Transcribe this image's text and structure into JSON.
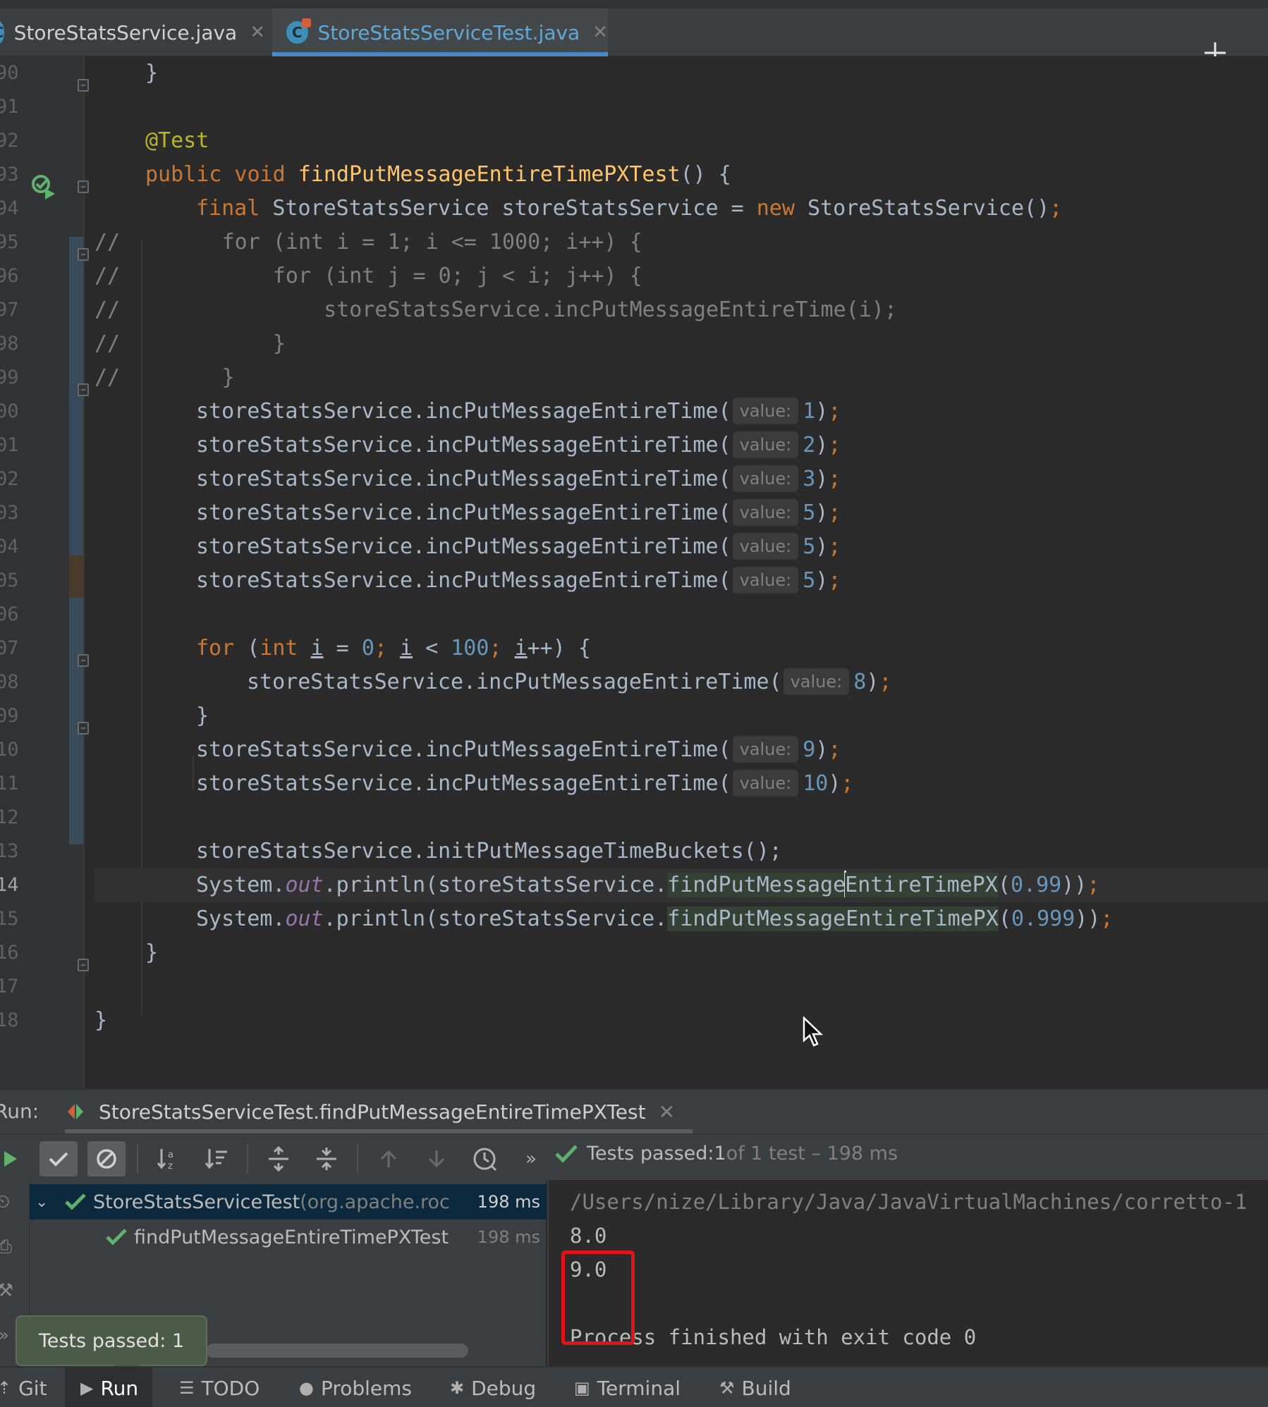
{
  "tabs": [
    {
      "label": "StoreStatsService.java",
      "active": false
    },
    {
      "label": "StoreStatsServiceTest.java",
      "active": true
    }
  ],
  "editor": {
    "line_numbers": [
      "90",
      "91",
      "92",
      "93",
      "94",
      "95",
      "96",
      "97",
      "98",
      "99",
      "00",
      "01",
      "02",
      "03",
      "04",
      "05",
      "06",
      "07",
      "08",
      "09",
      "10",
      "11",
      "12",
      "13",
      "14",
      "15",
      "16",
      "17",
      "18"
    ],
    "current_line": "14",
    "lines": {
      "l90": "}",
      "annotation": "@Test",
      "kw_public_void": "public void ",
      "method_name": "findPutMessageEntireTimePXTest",
      "method_tail": "() {",
      "kw_final": "final ",
      "decl_mid": "StoreStatsService storeStatsService = ",
      "kw_new": "new ",
      "decl_tail": "StoreStatsService()",
      "semi": ";",
      "c95": "//        for (int i = 1; i <= 1000; i++) {",
      "c96": "//            for (int j = 0; j < i; j++) {",
      "c97": "//                storeStatsService.incPutMessageEntireTime(i);",
      "c98": "//            }",
      "c99": "//        }",
      "inc_call": "storeStatsService.incPutMessageEntireTime(",
      "hint": "value:",
      "close": ")",
      "v100": "1",
      "v101": "2",
      "v102": "3",
      "v103": "5",
      "v104": "5",
      "v105": "5",
      "v108": "8",
      "v110": "9",
      "v111": "10",
      "kw_for": "for ",
      "for_open": "(",
      "kw_int": "int ",
      "var_i": "i",
      "eq": " = ",
      "zero": "0",
      "lt": " < ",
      "hundred": "100",
      "inc": "++",
      "for_tail": ") {",
      "brace_close": "}",
      "init_call": "storeStatsService.initPutMessageTimeBuckets();",
      "sys": "System.",
      "out": "out",
      "println": ".println(storeStatsService.",
      "find_a": "findPutMessage",
      "find_b": "EntireTimePX",
      "arg1": "0.99",
      "arg2": "0.999",
      "tail_close": "))",
      "class_close": "}"
    }
  },
  "run_panel": {
    "label": "Run:",
    "tab_label": "StoreStatsServiceTest.findPutMessageEntireTimePXTest",
    "status": {
      "prefix": "Tests passed: ",
      "count": "1",
      "suffix": " of 1 test – 198 ms"
    },
    "tree": [
      {
        "name": "StoreStatsServiceTest",
        "package": " (org.apache.roc",
        "time": "198 ms"
      },
      {
        "name": "findPutMessageEntireTimePXTest",
        "time": "198 ms"
      }
    ],
    "console": {
      "path": "/Users/nize/Library/Java/JavaVirtualMachines/corretto-1",
      "out1": "8.0",
      "out2": "9.0",
      "finish": "Process finished with exit code 0"
    },
    "tooltip": "Tests passed: 1"
  },
  "bottom_bar": [
    {
      "label": "Git"
    },
    {
      "label": "Run",
      "active": true
    },
    {
      "label": "TODO"
    },
    {
      "label": "Problems"
    },
    {
      "label": "Debug"
    },
    {
      "label": "Terminal"
    },
    {
      "label": "Build"
    }
  ],
  "colors": {
    "accent": "#4a88c7",
    "pass": "#5eb26b",
    "highlight_box": "#e0151b"
  }
}
